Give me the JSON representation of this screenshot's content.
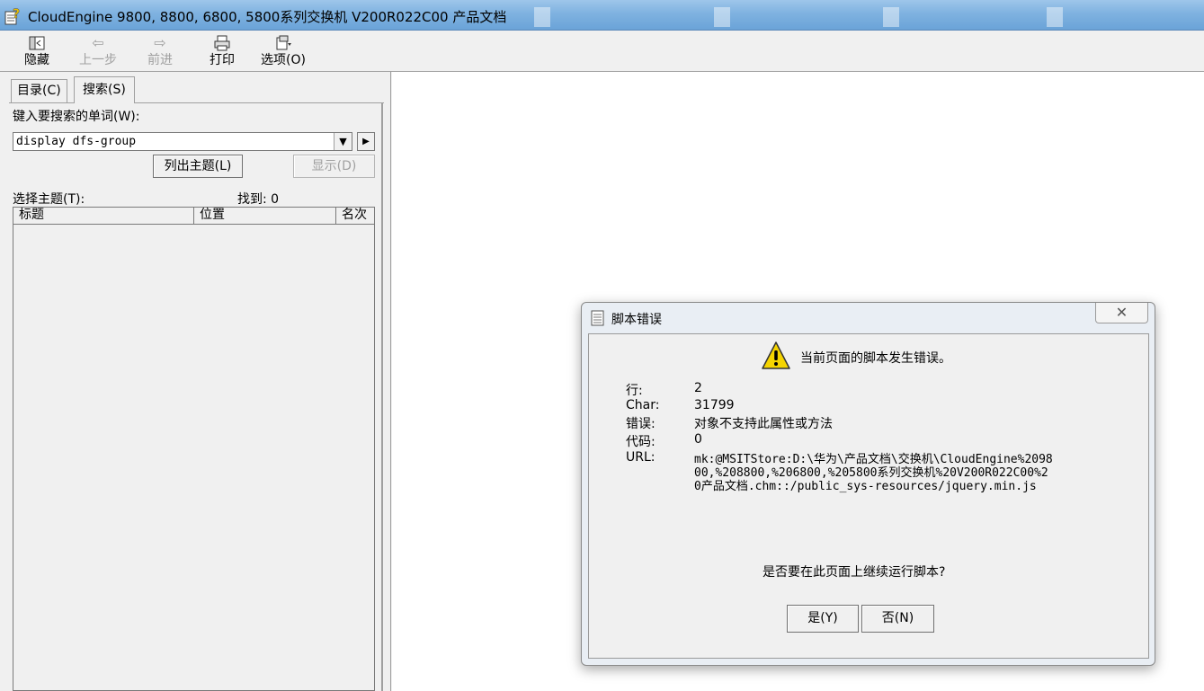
{
  "window": {
    "title": "CloudEngine 9800, 8800, 6800, 5800系列交换机 V200R022C00 产品文档"
  },
  "toolbar": {
    "hide_label": "隐藏",
    "back_label": "上一步",
    "forward_label": "前进",
    "print_label": "打印",
    "options_label": "选项(O)"
  },
  "tabs": {
    "contents_label": "目录(C)",
    "search_label": "搜索(S)"
  },
  "search": {
    "prompt_label": "键入要搜索的单词(W):",
    "value": "display dfs-group",
    "list_topics_label": "列出主题(L)",
    "display_label": "显示(D)",
    "select_topic_label": "选择主题(T):",
    "found_label": "找到: 0"
  },
  "results": {
    "columns": [
      "标题",
      "位置",
      "名次"
    ]
  },
  "dialog": {
    "title": "脚本错误",
    "close_glyph": "✕",
    "message": "当前页面的脚本发生错误。",
    "details": [
      {
        "key": "行:",
        "value": "2"
      },
      {
        "key": "Char:",
        "value": "31799"
      },
      {
        "key": "错误:",
        "value": "对象不支持此属性或方法"
      },
      {
        "key": "代码:",
        "value": "0"
      }
    ],
    "url_key": "URL:",
    "url_value": "mk:@MSITStore:D:\\华为\\产品文档\\交换机\\CloudEngine%209800,%208800,%206800,%205800系列交换机%20V200R022C00%20产品文档.chm::/public_sys-resources/jquery.min.js",
    "question": "是否要在此页面上继续运行脚本?",
    "yes_label": "是(Y)",
    "no_label": "否(N)"
  },
  "colors": {
    "titlebar": "#7fb2e0",
    "dialog_body": "#f0f0f0",
    "warning": "#f5d400"
  },
  "icons": [
    "help-book-icon",
    "hide-icon",
    "back-arrow-icon",
    "forward-arrow-icon",
    "print-icon",
    "options-icon",
    "dropdown-arrow-icon",
    "go-arrow-icon",
    "document-icon",
    "close-icon",
    "warning-icon"
  ]
}
